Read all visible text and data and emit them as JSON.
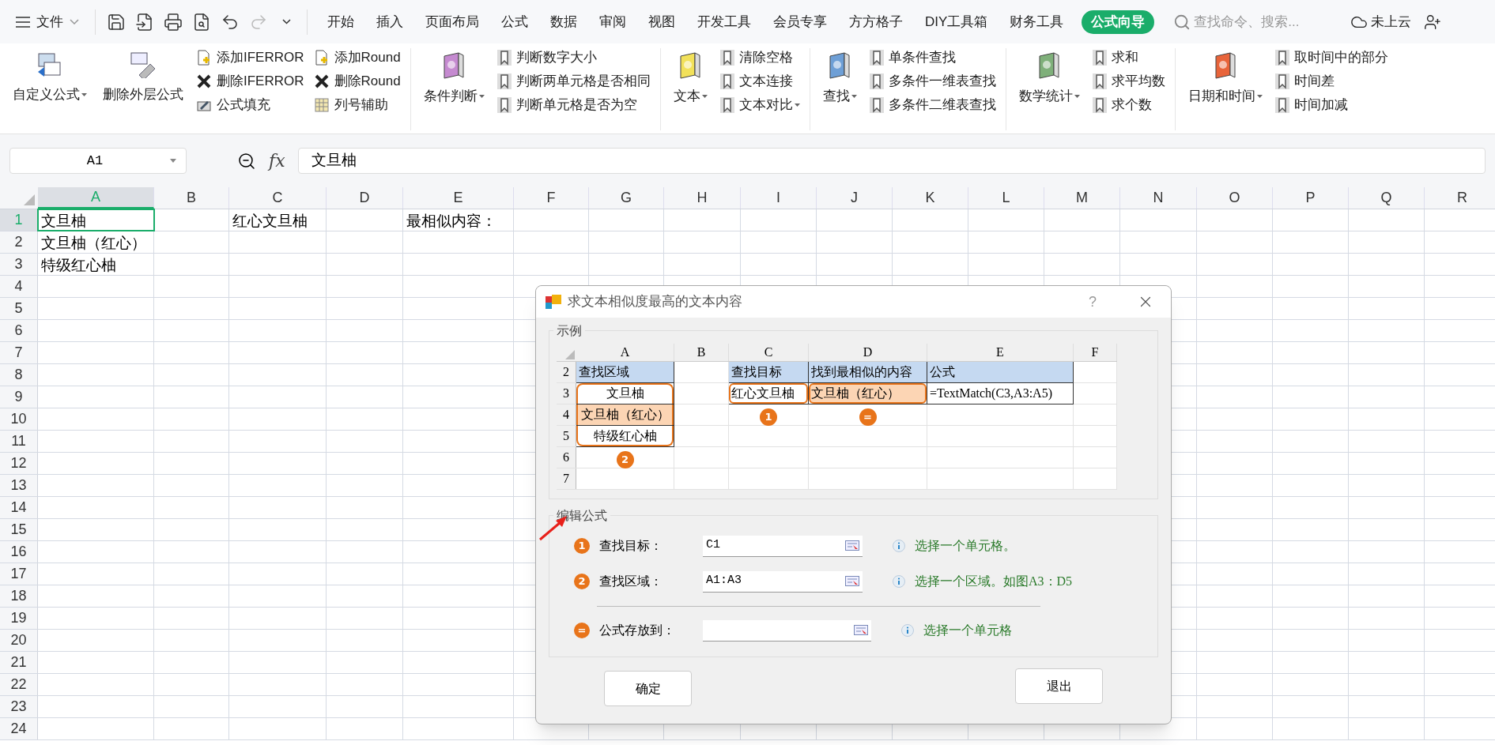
{
  "menu": {
    "file_label": "文件",
    "function_label": "fx",
    "tabs": [
      {
        "label": "开始",
        "selected": false
      },
      {
        "label": "插入",
        "selected": false
      },
      {
        "label": "页面布局",
        "selected": false
      },
      {
        "label": "公式",
        "selected": false
      },
      {
        "label": "数据",
        "selected": false
      },
      {
        "label": "审阅",
        "selected": false
      },
      {
        "label": "视图",
        "selected": false
      },
      {
        "label": "开发工具",
        "selected": false
      },
      {
        "label": "会员专享",
        "selected": false
      },
      {
        "label": "方方格子",
        "selected": false
      },
      {
        "label": "DIY工具箱",
        "selected": false
      },
      {
        "label": "财务工具",
        "selected": false
      },
      {
        "label": "公式向导",
        "selected": true
      }
    ],
    "search": {
      "placeholder": "查找命令、搜索..."
    },
    "cloud_label": "未上云"
  },
  "ribbon": [
    {
      "big": [
        {
          "label": "自定义公式",
          "dropdown": true
        },
        {
          "label": "删除外层公式",
          "dropdown": false
        }
      ],
      "columns": [
        [
          {
            "label": "添加IFERROR",
            "dropdown": false
          },
          {
            "label": "删除IFERROR",
            "dropdown": false
          },
          {
            "label": "公式填充",
            "dropdown": false
          }
        ],
        [
          {
            "label": "添加Round",
            "dropdown": false
          },
          {
            "label": "删除Round",
            "dropdown": false
          },
          {
            "label": "列号辅助",
            "dropdown": false
          }
        ]
      ]
    },
    {
      "big": [
        {
          "label": "条件判断",
          "dropdown": true
        }
      ],
      "columns": [
        [
          {
            "label": "判断数字大小",
            "dropdown": false
          },
          {
            "label": "判断两单元格是否相同",
            "dropdown": false
          },
          {
            "label": "判断单元格是否为空",
            "dropdown": false
          }
        ]
      ]
    },
    {
      "big": [
        {
          "label": "文本",
          "dropdown": true
        }
      ],
      "columns": [
        [
          {
            "label": "清除空格",
            "dropdown": false
          },
          {
            "label": "文本连接",
            "dropdown": false
          },
          {
            "label": "文本对比",
            "dropdown": true
          }
        ]
      ]
    },
    {
      "big": [
        {
          "label": "查找",
          "dropdown": true
        }
      ],
      "columns": [
        [
          {
            "label": "单条件查找",
            "dropdown": false
          },
          {
            "label": "多条件一维表查找",
            "dropdown": false
          },
          {
            "label": "多条件二维表查找",
            "dropdown": false
          }
        ]
      ]
    },
    {
      "big": [
        {
          "label": "数学统计",
          "dropdown": true
        }
      ],
      "columns": [
        [
          {
            "label": "求和",
            "dropdown": false
          },
          {
            "label": "求平均数",
            "dropdown": false
          },
          {
            "label": "求个数",
            "dropdown": false
          }
        ]
      ]
    },
    {
      "big": [
        {
          "label": "日期和时间",
          "dropdown": true
        }
      ],
      "columns": [
        [
          {
            "label": "取时间中的部分",
            "dropdown": false
          },
          {
            "label": "时间差",
            "dropdown": false
          },
          {
            "label": "时间加减",
            "dropdown": false
          }
        ]
      ]
    }
  ],
  "formula_bar": {
    "name_box": "A1",
    "formula": "文旦柚"
  },
  "sheet": {
    "columns": [
      {
        "label": "A",
        "selected": true
      },
      {
        "label": "B",
        "selected": false
      },
      {
        "label": "C",
        "selected": false
      },
      {
        "label": "D",
        "selected": false
      },
      {
        "label": "E",
        "selected": false
      },
      {
        "label": "F",
        "selected": false
      },
      {
        "label": "G",
        "selected": false
      },
      {
        "label": "H",
        "selected": false
      },
      {
        "label": "I",
        "selected": false
      },
      {
        "label": "J",
        "selected": false
      },
      {
        "label": "K",
        "selected": false
      },
      {
        "label": "L",
        "selected": false
      },
      {
        "label": "M",
        "selected": false
      },
      {
        "label": "N",
        "selected": false
      },
      {
        "label": "O",
        "selected": false
      },
      {
        "label": "P",
        "selected": false
      },
      {
        "label": "Q",
        "selected": false
      },
      {
        "label": "R",
        "selected": false
      }
    ],
    "rows": [
      {
        "label": "1",
        "selected": true,
        "cells": [
          {
            "text": "文旦柚"
          },
          {},
          {
            "text": "红心文旦柚"
          },
          {},
          {
            "text": "最相似内容："
          }
        ]
      },
      {
        "label": "2",
        "selected": false,
        "cells": [
          {
            "text": "文旦柚（红心）"
          }
        ]
      },
      {
        "label": "3",
        "selected": false,
        "cells": [
          {
            "text": "特级红心柚"
          }
        ]
      },
      {
        "label": "4",
        "selected": false
      },
      {
        "label": "5",
        "selected": false
      },
      {
        "label": "6",
        "selected": false
      },
      {
        "label": "7",
        "selected": false
      },
      {
        "label": "8",
        "selected": false
      },
      {
        "label": "9",
        "selected": false
      },
      {
        "label": "10",
        "selected": false
      },
      {
        "label": "11",
        "selected": false
      },
      {
        "label": "12",
        "selected": false
      },
      {
        "label": "13",
        "selected": false
      },
      {
        "label": "14",
        "selected": false
      },
      {
        "label": "15",
        "selected": false
      },
      {
        "label": "16",
        "selected": false
      },
      {
        "label": "17",
        "selected": false
      },
      {
        "label": "18",
        "selected": false
      },
      {
        "label": "19",
        "selected": false
      },
      {
        "label": "20",
        "selected": false
      },
      {
        "label": "21",
        "selected": false
      },
      {
        "label": "22",
        "selected": false
      },
      {
        "label": "23",
        "selected": false
      },
      {
        "label": "24",
        "selected": false
      }
    ]
  },
  "dialog": {
    "title": "求文本相似度最高的文本内容",
    "help": "?",
    "example": {
      "legend": "示例",
      "columns": [
        "A",
        "B",
        "C",
        "D",
        "E",
        "F"
      ],
      "rows": [
        {
          "label": "2",
          "cells": [
            {
              "text": "查找区域",
              "color": "#c5d9f1",
              "outlined": false
            },
            {
              "outlined": false
            },
            {
              "text": "查找目标",
              "color": "#c5d9f1",
              "outlined": false
            },
            {
              "text": "找到最相似的内容",
              "color": "#c5d9f1",
              "outlined": false
            },
            {
              "text": "公式",
              "color": "#c5d9f1",
              "outlined": false
            }
          ]
        },
        {
          "label": "3",
          "cells": [
            {
              "text": "文旦柚",
              "outlined": true
            },
            {
              "outlined": false
            },
            {
              "text": "红心文旦柚",
              "outlined": true,
              "marker": "1"
            },
            {
              "text": "文旦柚（红心）",
              "color": "#fcd5b4",
              "outlined": true,
              "marker": "="
            },
            {
              "text": "=TextMatch(C3,A3:A5)",
              "outlined": false
            }
          ]
        },
        {
          "label": "4",
          "cells": [
            {
              "text": "文旦柚（红心）",
              "color": "#fcd5b4",
              "outlined": true
            }
          ]
        },
        {
          "label": "5",
          "cells": [
            {
              "text": "特级红心柚",
              "outlined": true,
              "marker": "2"
            }
          ]
        },
        {
          "label": "6"
        },
        {
          "label": "7"
        }
      ]
    },
    "edit": {
      "legend": "编辑公式",
      "fields": [
        {
          "badge": "1",
          "label": "查找目标：",
          "value": "C1",
          "hint": "选择一个单元格。"
        },
        {
          "badge": "2",
          "label": "查找区域：",
          "value": "A1:A3",
          "hint": "选择一个区域。如图A3：D5"
        },
        {
          "badge": "=",
          "label": "公式存放到：",
          "hint": "选择一个单元格"
        }
      ]
    },
    "buttons": [
      "确定",
      "退出"
    ]
  }
}
